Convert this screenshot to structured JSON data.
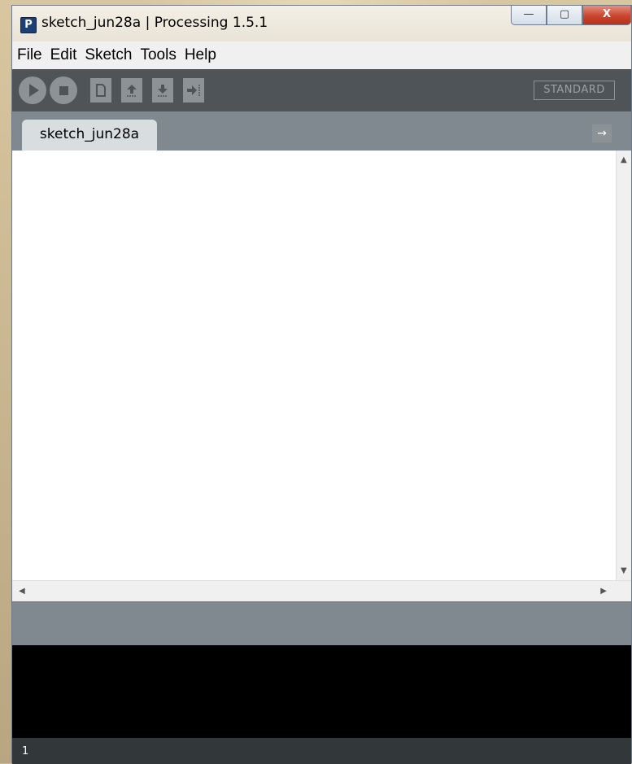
{
  "window": {
    "title": "sketch_jun28a | Processing 1.5.1",
    "app_icon_letter": "P",
    "controls": {
      "minimize": "—",
      "maximize": "▢",
      "close": "X"
    }
  },
  "menu": [
    "File",
    "Edit",
    "Sketch",
    "Tools",
    "Help"
  ],
  "toolbar": {
    "buttons": [
      "run-icon",
      "stop-icon",
      "new-icon",
      "open-icon",
      "save-icon",
      "export-icon"
    ],
    "mode_label": "STANDARD"
  },
  "tabs": [
    {
      "label": "sketch_jun28a",
      "active": true
    }
  ],
  "tab_arrow": "→",
  "editor": {
    "content": ""
  },
  "scroll_arrows": {
    "up": "▲",
    "down": "▼",
    "left": "◀",
    "right": "▶"
  },
  "console": {
    "text": ""
  },
  "status_line": "1",
  "colors": {
    "toolbar_bg": "#4e5458",
    "tabbar_bg": "#7f898f",
    "console_bg": "#000000",
    "button_fill": "#8c9396"
  }
}
